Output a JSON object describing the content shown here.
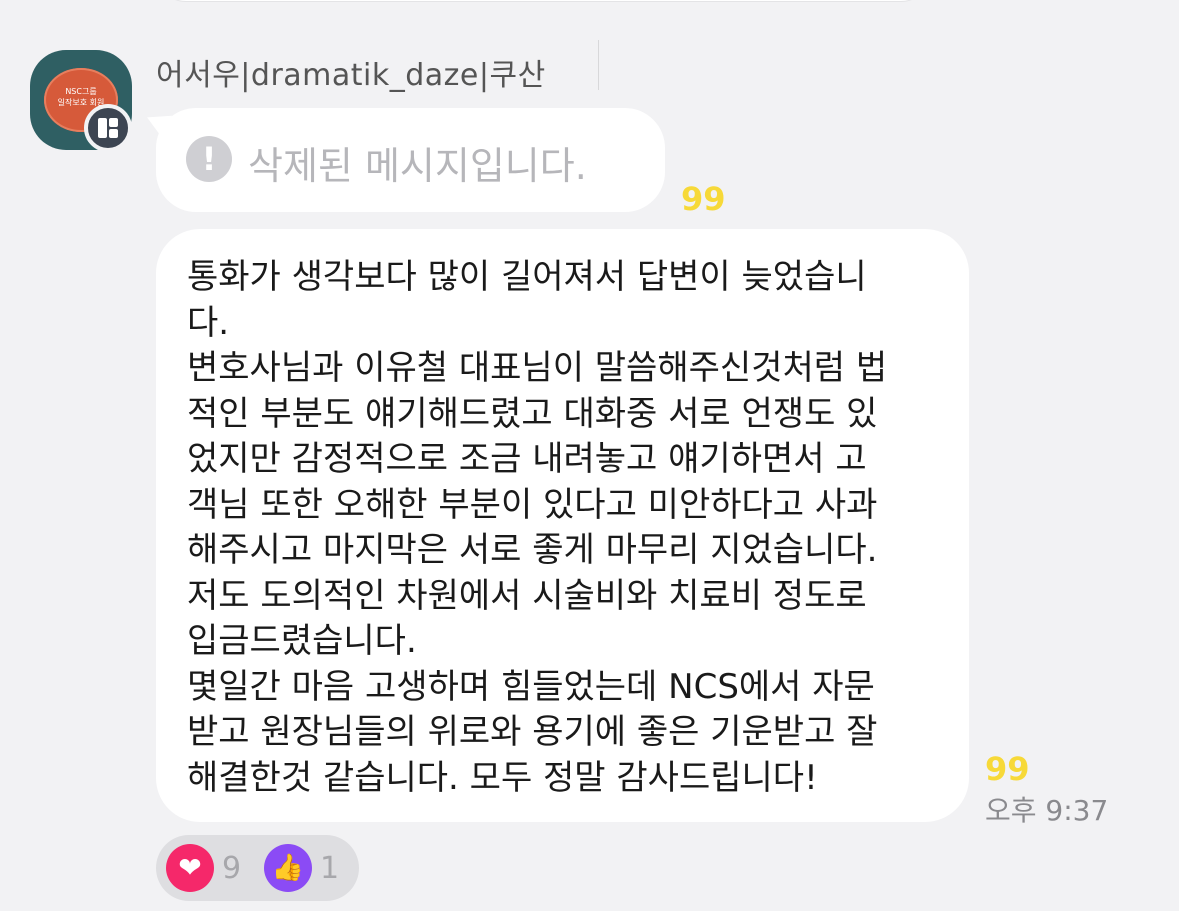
{
  "sender": {
    "name": "어서우|dramatik_daze|쿠산",
    "avatar_text_line1": "NSC그룹",
    "avatar_text_line2": "일작보호 회원"
  },
  "deleted_message": {
    "text": "삭제된 메시지입니다.",
    "unread_count": "99",
    "icon": "exclamation-icon"
  },
  "main_message": {
    "lines": [
      "통화가 생각보다 많이 길어져서 답변이 늦었습니",
      "다.",
      "변호사님과 이유철 대표님이 말씀해주신것처럼 법",
      "적인 부분도 얘기해드렸고 대화중 서로 언쟁도 있",
      "었지만 감정적으로 조금 내려놓고 얘기하면서 고",
      "객님 또한 오해한 부분이 있다고 미안하다고 사과",
      "해주시고 마지막은 서로 좋게 마무리 지었습니다.",
      "저도 도의적인 차원에서 시술비와 치료비 정도로",
      "입금드렸습니다.",
      "몇일간 마음 고생하며 힘들었는데 NCS에서 자문",
      "받고 원장님들의 위로와 용기에 좋은 기운받고 잘",
      "해결한것 같습니다. 모두 정말 감사드립니다!"
    ],
    "unread_count": "99",
    "time": "오후 9:37"
  },
  "reactions": {
    "heart": {
      "icon": "heart-icon",
      "count": "9"
    },
    "thumbs_up": {
      "icon": "thumbs-up-icon",
      "count": "1"
    }
  },
  "colors": {
    "background": "#f2f2f4",
    "bubble": "#ffffff",
    "unread": "#f7d938",
    "heart": "#f5286a",
    "thumb": "#8b4bf5"
  }
}
